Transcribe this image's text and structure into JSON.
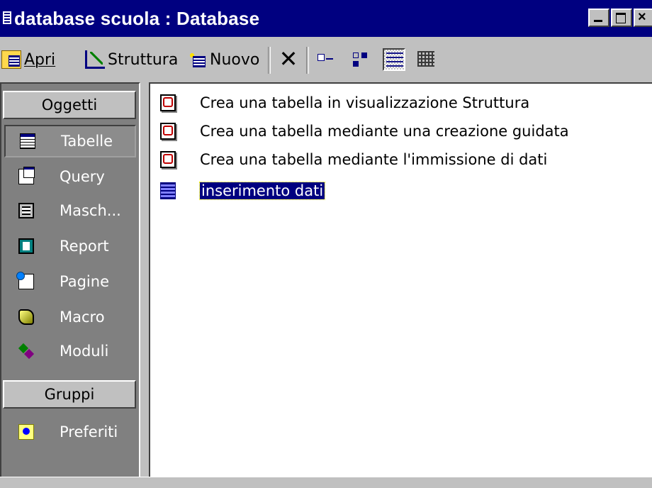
{
  "window": {
    "title": "database scuola : Database",
    "close_glyph": "×"
  },
  "toolbar": {
    "open_label": "Apri",
    "design_label": "Struttura",
    "new_label": "Nuovo",
    "delete_glyph": "✕"
  },
  "sidebar": {
    "objects_header": "Oggetti",
    "items": [
      {
        "label": "Tabelle",
        "icon": "table-icon"
      },
      {
        "label": "Query",
        "icon": "query-icon"
      },
      {
        "label": "Masch...",
        "icon": "form-icon"
      },
      {
        "label": "Report",
        "icon": "report-icon"
      },
      {
        "label": "Pagine",
        "icon": "page-icon"
      },
      {
        "label": "Macro",
        "icon": "macro-icon"
      },
      {
        "label": "Moduli",
        "icon": "module-icon"
      }
    ],
    "groups_header": "Gruppi",
    "groups": [
      {
        "label": "Preferiti",
        "icon": "favorites-icon"
      }
    ]
  },
  "list": {
    "items": [
      {
        "label": "Crea una tabella in visualizzazione Struttura",
        "icon": "wizard-icon"
      },
      {
        "label": "Crea una tabella mediante una creazione guidata",
        "icon": "wizard-icon"
      },
      {
        "label": "Crea una tabella mediante l'immissione di dati",
        "icon": "wizard-icon"
      },
      {
        "label": "inserimento dati",
        "icon": "table-icon",
        "selected": true
      }
    ]
  },
  "colors": {
    "titlebar": "#000080",
    "selection": "#000080",
    "sidebar_bg": "#808080",
    "face": "#c0c0c0"
  }
}
